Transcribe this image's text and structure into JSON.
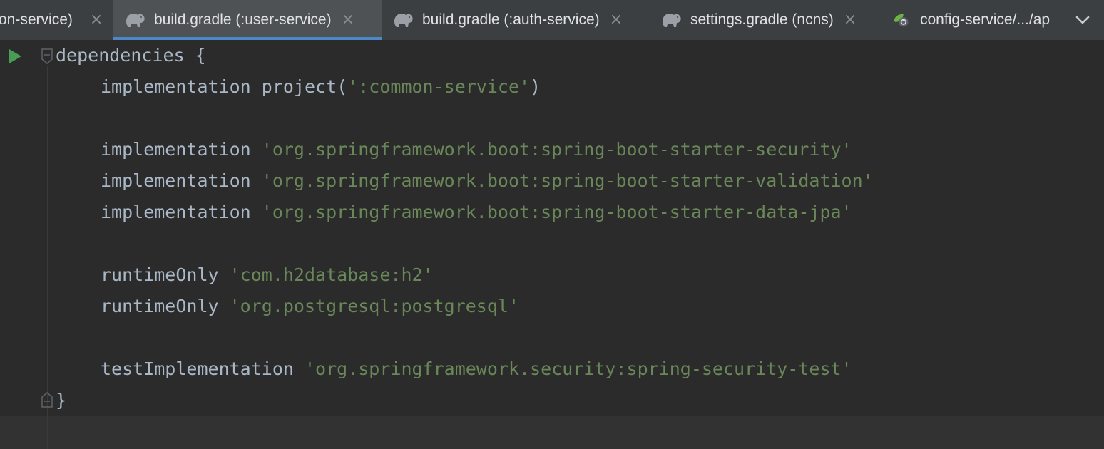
{
  "tabs": [
    {
      "label": "on-service)",
      "active": false,
      "icon": "gradle-elephant-icon",
      "closable": true
    },
    {
      "label": "build.gradle (:user-service)",
      "active": true,
      "icon": "gradle-elephant-icon",
      "closable": true
    },
    {
      "label": "build.gradle (:auth-service)",
      "active": false,
      "icon": "gradle-elephant-icon",
      "closable": true
    },
    {
      "label": "settings.gradle (ncns)",
      "active": false,
      "icon": "gradle-elephant-icon",
      "closable": true
    },
    {
      "label": "config-service/.../ap",
      "active": false,
      "icon": "spring-boot-leaf-icon",
      "closable": false
    }
  ],
  "tab_close_glyph": "×",
  "tab_overflow_icon": "chevron-down-icon",
  "editor": {
    "lines": [
      {
        "keyword": "dependencies",
        "rest": " {",
        "string": "",
        "tail": ""
      },
      {
        "keyword": "implementation project(",
        "rest": "",
        "string": "':common-service'",
        "tail": ")"
      },
      {
        "keyword": "implementation ",
        "rest": "",
        "string": "'org.springframework.boot:spring-boot-starter-security'",
        "tail": ""
      },
      {
        "keyword": "implementation ",
        "rest": "",
        "string": "'org.springframework.boot:spring-boot-starter-validation'",
        "tail": ""
      },
      {
        "keyword": "implementation ",
        "rest": "",
        "string": "'org.springframework.boot:spring-boot-starter-data-jpa'",
        "tail": ""
      },
      {
        "keyword": "runtimeOnly ",
        "rest": "",
        "string": "'com.h2database:h2'",
        "tail": ""
      },
      {
        "keyword": "runtimeOnly ",
        "rest": "",
        "string": "'org.postgresql:postgresql'",
        "tail": ""
      },
      {
        "keyword": "testImplementation ",
        "rest": "",
        "string": "'org.springframework.security:spring-security-test'",
        "tail": ""
      },
      {
        "keyword": "}",
        "rest": "",
        "string": "",
        "tail": ""
      }
    ],
    "gutter": {
      "run_icon": "run-triangle-icon",
      "fold_icon": "fold-marker-icon"
    }
  },
  "colors": {
    "background": "#2b2b2b",
    "tabbar": "#3c3f41",
    "active_tab": "#4e5254",
    "active_tab_underline": "#4a88c7",
    "code_text": "#a9b7c6",
    "string_literal": "#6a8759",
    "run_icon": "#499c54"
  }
}
